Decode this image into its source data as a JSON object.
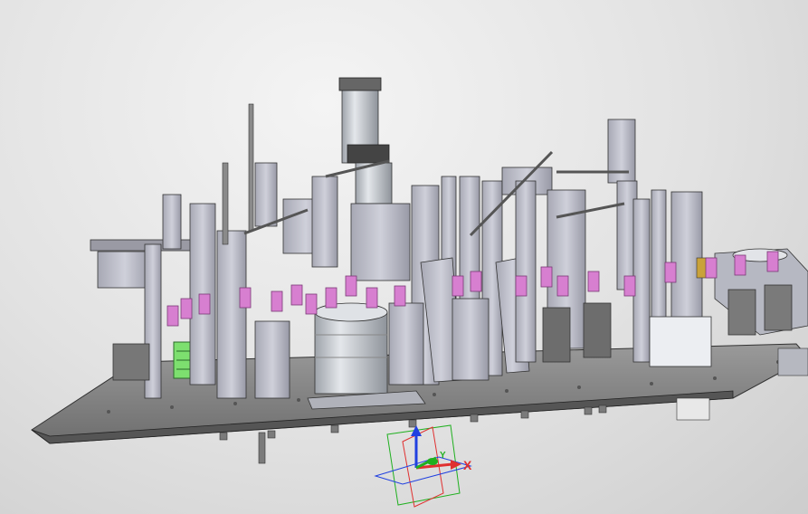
{
  "viewport": {
    "background_top": "#f4f4f4",
    "background_bottom": "#cdcdcd"
  },
  "model": {
    "plate_color": "#8a8a8a",
    "frame_color": "#b8b8c2",
    "accent_pink": "#d77fd0",
    "accent_green": "#7ddf6f",
    "cylinder_color": "#c8ccd2"
  },
  "triad": {
    "x_label": "X",
    "y_label": "Y",
    "x_color": "#e03030",
    "y_color": "#20b020",
    "z_color": "#2040e0"
  }
}
